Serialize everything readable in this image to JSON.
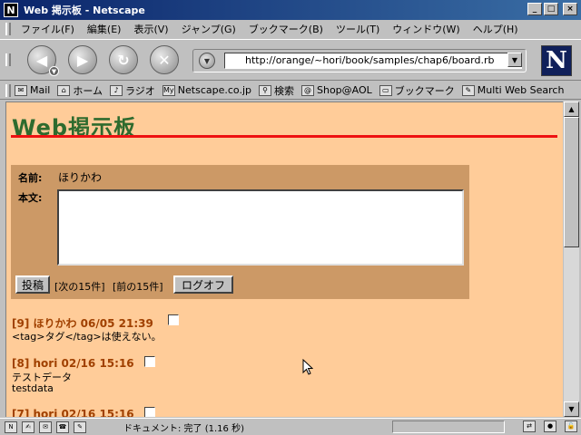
{
  "window": {
    "title": "Web 掲示板 - Netscape",
    "logo": "N",
    "minimize": "_",
    "maximize": "□",
    "close": "×"
  },
  "menu": [
    "ファイル(F)",
    "編集(E)",
    "表示(V)",
    "ジャンプ(G)",
    "ブックマーク(B)",
    "ツール(T)",
    "ウィンドウ(W)",
    "ヘルプ(H)"
  ],
  "nav": {
    "back_icon": "back-arrow",
    "forward_icon": "forward-arrow",
    "reload_icon": "reload",
    "stop_icon": "stop",
    "url": "http://orange/~hori/book/samples/chap6/board.rb",
    "brand": "N"
  },
  "personal_toolbar": [
    {
      "icon": "mail-icon",
      "label": "Mail"
    },
    {
      "icon": "home-icon",
      "label": "ホーム"
    },
    {
      "icon": "radio-icon",
      "label": "ラジオ"
    },
    {
      "icon": "my-icon",
      "label": "Netscape.co.jp"
    },
    {
      "icon": "search-icon",
      "label": "検索"
    },
    {
      "icon": "shop-icon",
      "label": "Shop@AOL"
    },
    {
      "icon": "bookmark-folder-icon",
      "label": "ブックマーク"
    },
    {
      "icon": "multi-search-icon",
      "label": "Multi Web Search"
    }
  ],
  "page": {
    "title": "Web掲示板",
    "form": {
      "name_label": "名前:",
      "name_value": "ほりかわ",
      "body_label": "本文:",
      "body_value": "",
      "post_button": "投稿",
      "next_link": "[次の15件]",
      "prev_link": "[前の15件]",
      "logout_button": "ログオフ"
    },
    "posts": [
      {
        "header": "[9] ほりかわ 06/05 21:39",
        "lines": [
          "<tag>タグ</tag>は使えない。"
        ]
      },
      {
        "header": "[8] hori 02/16 15:16",
        "lines": [
          "テストデータ",
          "testdata"
        ]
      },
      {
        "header": "[7] hori 02/16 15:16",
        "lines": []
      }
    ]
  },
  "status": {
    "text": "ドキュメント: 完了 (1.16 秒)"
  }
}
